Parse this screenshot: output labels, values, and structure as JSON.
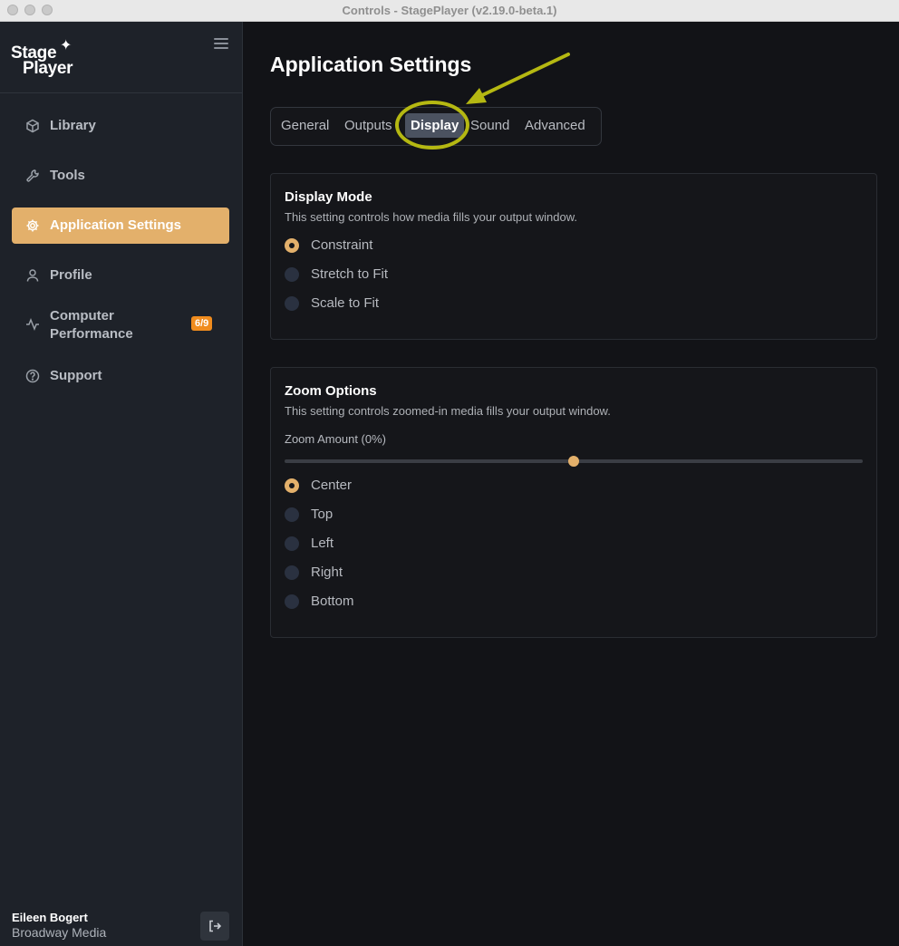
{
  "window": {
    "title": "Controls - StagePlayer (v2.19.0-beta.1)"
  },
  "sidebar": {
    "logo_line1": "Stage",
    "logo_line2": "Player",
    "items": [
      {
        "label": "Library",
        "icon": "cube-icon"
      },
      {
        "label": "Tools",
        "icon": "wrench-icon"
      },
      {
        "label": "Application Settings",
        "icon": "gear-icon",
        "active": true
      },
      {
        "label": "Profile",
        "icon": "user-icon"
      },
      {
        "label": "Computer\nPerformance",
        "icon": "activity-icon",
        "badge": "6/9"
      },
      {
        "label": "Support",
        "icon": "help-circle-icon"
      }
    ],
    "user": {
      "name": "Eileen Bogert",
      "org": "Broadway Media"
    }
  },
  "main": {
    "title": "Application Settings",
    "tabs": [
      {
        "label": "General"
      },
      {
        "label": "Outputs"
      },
      {
        "label": "Display",
        "active": true
      },
      {
        "label": "Sound"
      },
      {
        "label": "Advanced"
      }
    ],
    "display_mode": {
      "title": "Display Mode",
      "description": "This setting controls how media fills your output window.",
      "options": [
        "Constraint",
        "Stretch to Fit",
        "Scale to Fit"
      ],
      "selected": "Constraint"
    },
    "zoom_options": {
      "title": "Zoom Options",
      "description": "This setting controls zoomed-in media fills your output window.",
      "zoom_label": "Zoom Amount (0%)",
      "zoom_slider_fraction": 0.5,
      "options": [
        "Center",
        "Top",
        "Left",
        "Right",
        "Bottom"
      ],
      "selected": "Center"
    }
  },
  "colors": {
    "accent": "#e3b06b",
    "badge": "#f08c1e",
    "annotation": "#b5b812"
  }
}
